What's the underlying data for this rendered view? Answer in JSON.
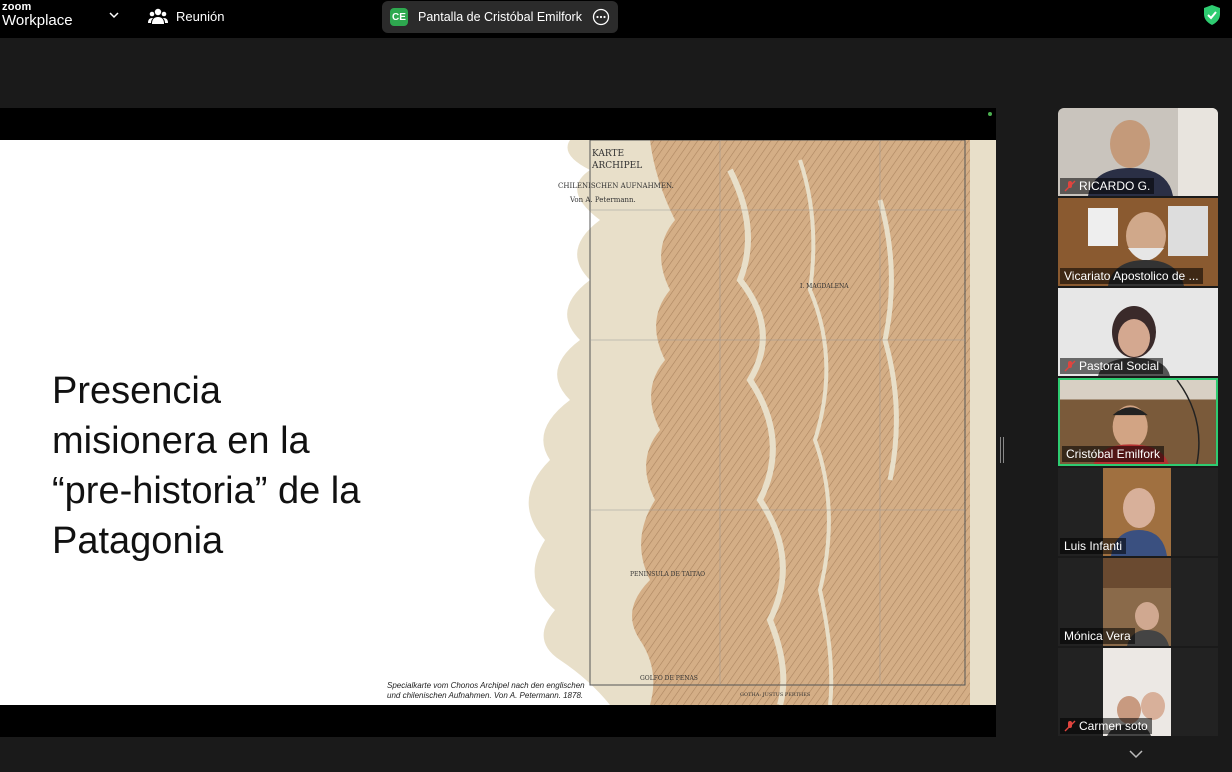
{
  "app": {
    "logo_top": "zoom",
    "logo_bottom": "Workplace"
  },
  "meeting": {
    "title": "Reunión"
  },
  "share_indicator": {
    "avatar": "CE",
    "label": "Pantalla de Cristóbal Emilfork"
  },
  "slide": {
    "title": "Presencia\nmisionera en la\n“pre-historia” de la\nPatagonia",
    "caption_line1": "Specialkarte vom Chonos Archipel nach den englischen",
    "caption_line2": "und chilenischen Aufnahmen. Von A. Petermann.  1878."
  },
  "participants": [
    {
      "name": "RICARDO G.",
      "muted": true
    },
    {
      "name": "Vicariato Apostolico de ...",
      "muted": false
    },
    {
      "name": "Pastoral Social",
      "muted": true
    },
    {
      "name": "Cristóbal Emilfork",
      "muted": false,
      "active": true
    },
    {
      "name": "Luis Infanti",
      "muted": false
    },
    {
      "name": "Mónica Vera",
      "muted": false
    },
    {
      "name": "Carmen soto",
      "muted": true
    }
  ],
  "colors": {
    "active_speaker_border": "#2ecc71",
    "mute_icon": "#e0443e",
    "share_avatar": "#2ea84f",
    "security_shield": "#2ecc71"
  },
  "icons": {
    "logo_chevron": "chevron-down-icon",
    "meeting": "participants-icon",
    "more": "more-options-icon",
    "security": "shield-check-icon",
    "mute": "muted-mic-icon",
    "scroll": "chevron-down-icon"
  }
}
